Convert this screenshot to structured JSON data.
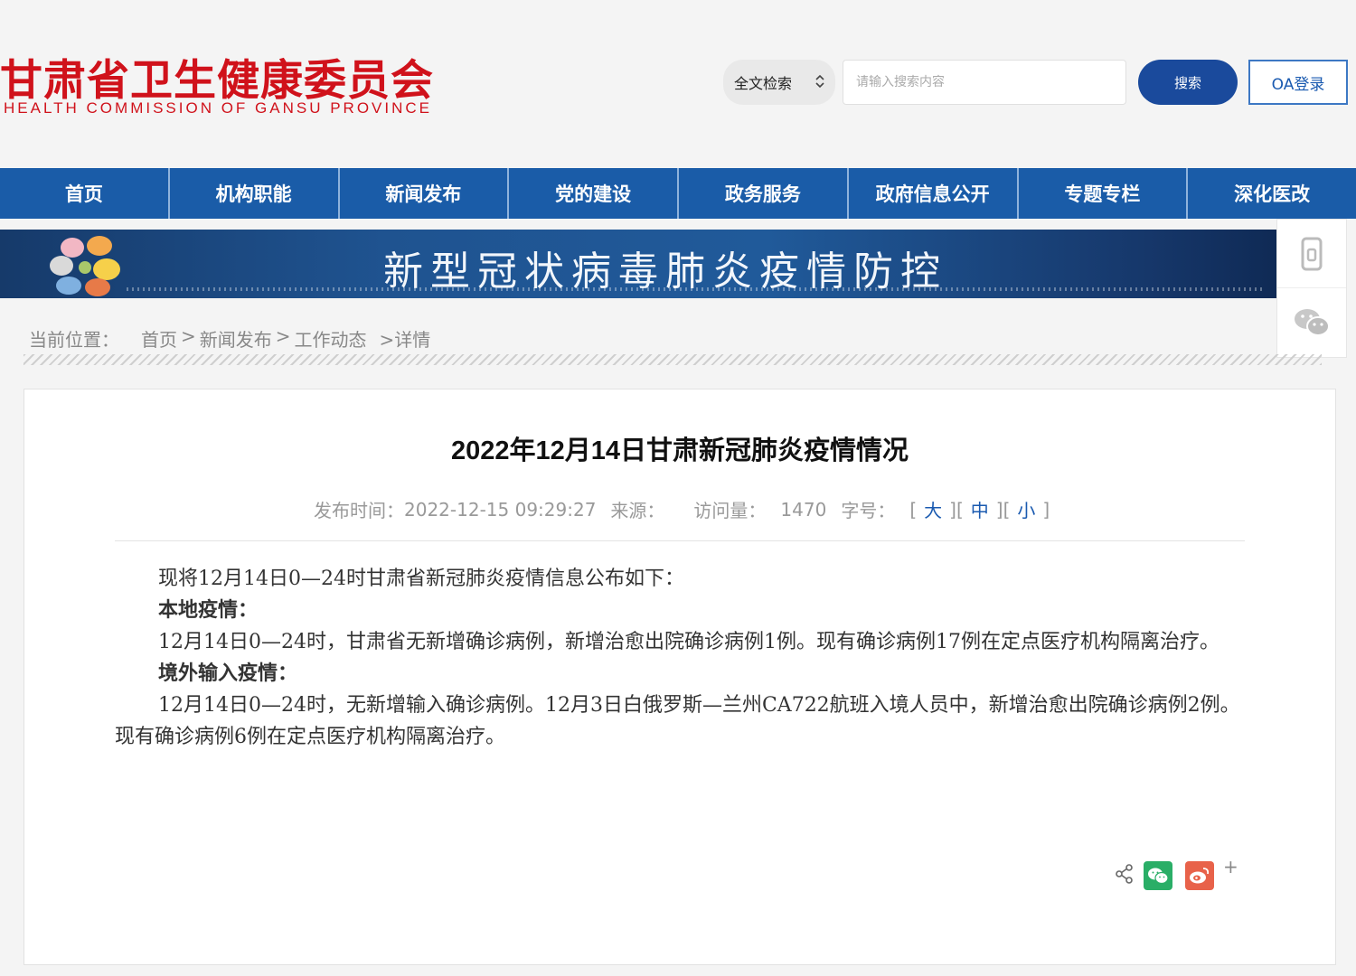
{
  "header": {
    "logo_cn": "甘肃省卫生健康委员会",
    "logo_en": "HEALTH  COMMISSION  OF  GANSU PROVINCE",
    "search_scope": "全文检索",
    "search_placeholder": "请输入搜索内容",
    "search_button": "搜索",
    "oa_button": "OA登录"
  },
  "nav": {
    "items": [
      "首页",
      "机构职能",
      "新闻发布",
      "党的建设",
      "政务服务",
      "政府信息公开",
      "专题专栏",
      "深化医改"
    ]
  },
  "banner": {
    "text": "新型冠状病毒肺炎疫情防控"
  },
  "breadcrumb": {
    "label": "当前位置：",
    "items": [
      "首页",
      ">",
      "新闻发布",
      ">",
      "工作动态",
      ">详情"
    ]
  },
  "article": {
    "title": "2022年12月14日甘肃新冠肺炎疫情情况",
    "meta": {
      "publish_label": "发布时间：",
      "publish_time": "2022-12-15 09:29:27",
      "source_label": "来源：",
      "visits_label": "访问量：",
      "visits": "1470",
      "font_label": "字号：",
      "size_large": "大",
      "size_medium": "中",
      "size_small": "小",
      "bracket_open": "[",
      "bracket_close": "]"
    },
    "paragraphs": [
      {
        "text": "现将12月14日0—24时甘肃省新冠肺炎疫情信息公布如下：",
        "bold": false
      },
      {
        "text": "本地疫情：",
        "bold": true
      },
      {
        "text": "12月14日0—24时，甘肃省无新增确诊病例，新增治愈出院确诊病例1例。现有确诊病例17例在定点医疗机构隔离治疗。",
        "bold": false
      },
      {
        "text": "境外输入疫情：",
        "bold": true
      },
      {
        "text": "12月14日0—24时，无新增输入确诊病例。12月3日白俄罗斯—兰州CA722航班入境人员中，新增治愈出院确诊病例2例。现有确诊病例6例在定点医疗机构隔离治疗。",
        "bold": false
      }
    ]
  },
  "share": {
    "plus": "+"
  },
  "colors": {
    "brand_red": "#d0121b",
    "nav_blue": "#1a5ca8",
    "button_blue": "#1a4a9c",
    "link_blue": "#1a5ab0"
  }
}
